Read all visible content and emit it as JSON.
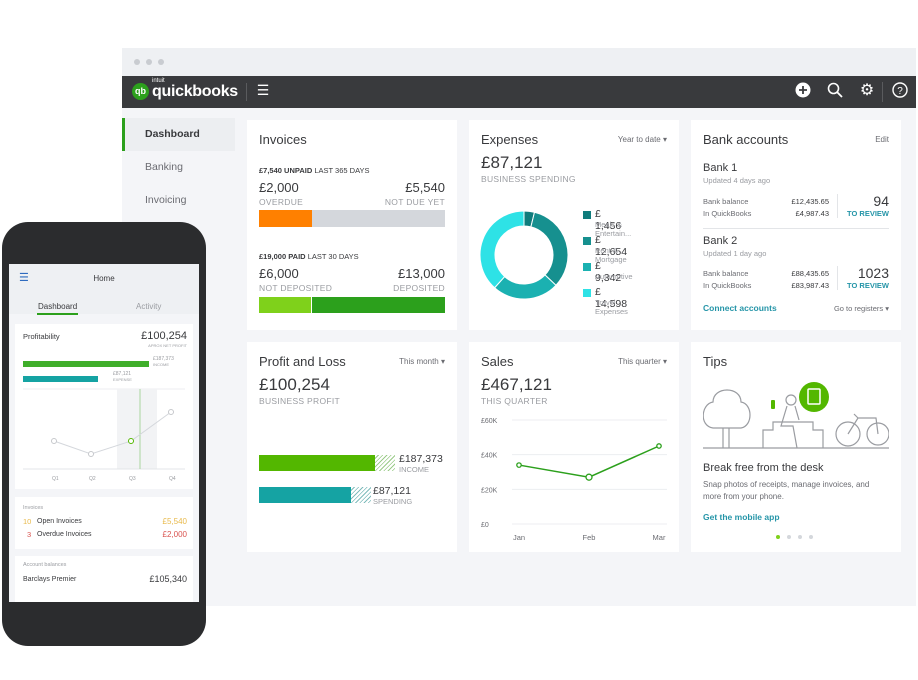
{
  "app": {
    "brand_prefix": "intuit",
    "brand": "quickbooks",
    "logo_badge": "qb"
  },
  "topbar": {
    "menu_icon": "hamburger-icon",
    "icons": [
      "plus-circle-icon",
      "search-icon",
      "gear-icon",
      "help-icon"
    ],
    "color": "#393a3d"
  },
  "sidebar": {
    "items": [
      {
        "label": "Dashboard",
        "active": true
      },
      {
        "label": "Banking"
      },
      {
        "label": "Invoicing"
      }
    ]
  },
  "colors": {
    "green": "#2ca01c",
    "orange": "#ff8000",
    "light_green": "#7fd11b",
    "teal": "#15a3a3",
    "link": "#0077c5"
  },
  "invoices": {
    "title": "Invoices",
    "unpaid": {
      "amount": "£7,540",
      "word": "UNPAID",
      "period": "LAST 365 DAYS",
      "left_value": "£2,000",
      "left_label": "OVERDUE",
      "right_value": "£5,540",
      "right_label": "NOT DUE YET",
      "fraction": 0.265
    },
    "paid": {
      "amount": "£19,000",
      "word": "PAID",
      "period": "LAST 30 DAYS",
      "left_value": "£6,000",
      "left_label": "NOT DEPOSITED",
      "right_value": "£13,000",
      "right_label": "DEPOSITED",
      "fraction": 0.316
    }
  },
  "expenses": {
    "title": "Expenses",
    "period": "Year to date",
    "total": "£87,121",
    "total_label": "BUSINESS SPENDING",
    "legend": [
      {
        "value": "£ 1,456",
        "label": "Meals & Entertain...",
        "amount": 1456,
        "color": "#0f7c7c"
      },
      {
        "value": "£ 12,654",
        "label": "Rent & Mortgage",
        "amount": 12654,
        "color": "#16908f"
      },
      {
        "value": "£ 9,342",
        "label": "Automotive",
        "amount": 9342,
        "color": "#1bb1b1"
      },
      {
        "value": "£ 14,598",
        "label": "Travel Expenses",
        "amount": 14598,
        "color": "#2ee2e6"
      }
    ]
  },
  "bank": {
    "title": "Bank accounts",
    "edit": "Edit",
    "accounts": [
      {
        "name": "Bank 1",
        "updated": "Updated 4 days ago",
        "balance_label": "Bank balance",
        "balance": "£12,435.65",
        "qb_label": "In QuickBooks",
        "qb": "£4,987.43",
        "review_count": "94",
        "review_label": "TO REVIEW"
      },
      {
        "name": "Bank 2",
        "updated": "Updated 1 day ago",
        "balance_label": "Bank balance",
        "balance": "£88,435.65",
        "qb_label": "In QuickBooks",
        "qb": "£83,987.43",
        "review_count": "1023",
        "review_label": "TO REVIEW"
      }
    ],
    "connect": "Connect accounts",
    "registers": "Go to registers"
  },
  "pnl": {
    "title": "Profit and Loss",
    "period": "This month",
    "total": "£100,254",
    "total_label": "BUSINESS PROFIT",
    "income": {
      "value": "£187,373",
      "label": "INCOME"
    },
    "spending": {
      "value": "£87,121",
      "label": "SPENDING"
    }
  },
  "sales": {
    "title": "Sales",
    "period": "This quarter",
    "total": "£467,121",
    "total_label": "THIS QUARTER"
  },
  "chart_data": {
    "type": "line",
    "categories": [
      "Jan",
      "Feb",
      "Mar"
    ],
    "values": [
      34000,
      27000,
      45000
    ],
    "ylim": [
      0,
      60000
    ],
    "yticks": [
      "£0",
      "£20K",
      "£40K",
      "£60K"
    ],
    "tick_values": [
      0,
      20000,
      40000,
      60000
    ],
    "grid": true,
    "color": "#2ca01c"
  },
  "tips": {
    "title": "Tips",
    "heading": "Break free from the desk",
    "body": "Snap photos of receipts, manage invoices, and more from your phone.",
    "link": "Get the mobile app",
    "pages": 4,
    "current_page": 1
  },
  "phone": {
    "title": "Home",
    "tabs": [
      "Dashboard",
      "Activity"
    ],
    "profitability": {
      "title": "Profitability",
      "value": "£100,254",
      "label": "APROX NET PROFIT",
      "income": "£187,373",
      "income_label": "INCOME",
      "expense": "£87,121",
      "expense_label": "EXPENSE",
      "quarters": [
        "Q1",
        "Q2",
        "Q3",
        "Q4"
      ]
    },
    "invoices": {
      "title": "Invoices",
      "open_count": "10",
      "open_label": "Open Invoices",
      "open_value": "£5,540",
      "overdue_count": "3",
      "overdue_label": "Overdue Invoices",
      "overdue_value": "£2,000"
    },
    "balances": {
      "title": "Account balances",
      "name": "Barclays Premier",
      "value": "£105,340"
    }
  }
}
